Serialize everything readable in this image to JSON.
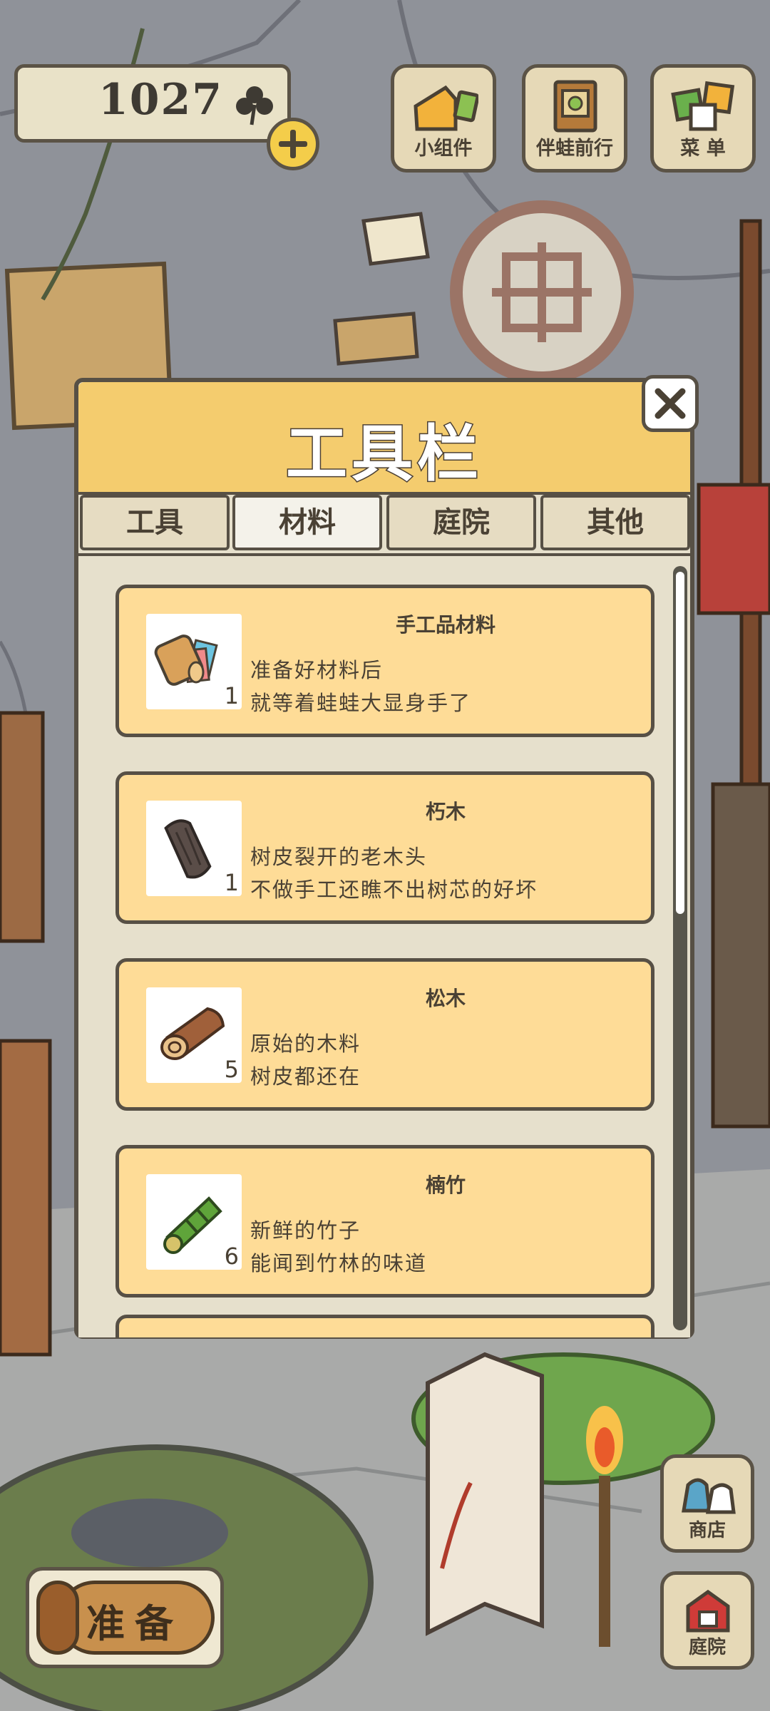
{
  "hud": {
    "clover_count": "1027",
    "buttons": [
      {
        "label": "小组件",
        "icon": "widget-icon"
      },
      {
        "label": "伴蛙前行",
        "icon": "journal-icon"
      },
      {
        "label": "菜 单",
        "icon": "menu-icon"
      }
    ]
  },
  "modal": {
    "title": "工具栏",
    "tabs": [
      {
        "label": "工具",
        "active": false
      },
      {
        "label": "材料",
        "active": true
      },
      {
        "label": "庭院",
        "active": false
      },
      {
        "label": "其他",
        "active": false
      }
    ],
    "items": [
      {
        "name": "手工品材料",
        "desc1": "准备好材料后",
        "desc2": "就等着蛙蛙大显身手了",
        "count": "1",
        "icon": "craft-materials-icon"
      },
      {
        "name": "朽木",
        "desc1": "树皮裂开的老木头",
        "desc2": "不做手工还瞧不出树芯的好坏",
        "count": "1",
        "icon": "rotten-wood-icon"
      },
      {
        "name": "松木",
        "desc1": "原始的木料",
        "desc2": "树皮都还在",
        "count": "5",
        "icon": "pine-wood-icon"
      },
      {
        "name": "楠竹",
        "desc1": "新鲜的竹子",
        "desc2": "能闻到竹林的味道",
        "count": "6",
        "icon": "bamboo-icon"
      }
    ]
  },
  "bottom": {
    "prepare_label": "准备",
    "shop_label": "商店",
    "yard_label": "庭院"
  },
  "colors": {
    "header": "#f4cc6e",
    "card": "#fedc97",
    "outline": "#575045"
  }
}
